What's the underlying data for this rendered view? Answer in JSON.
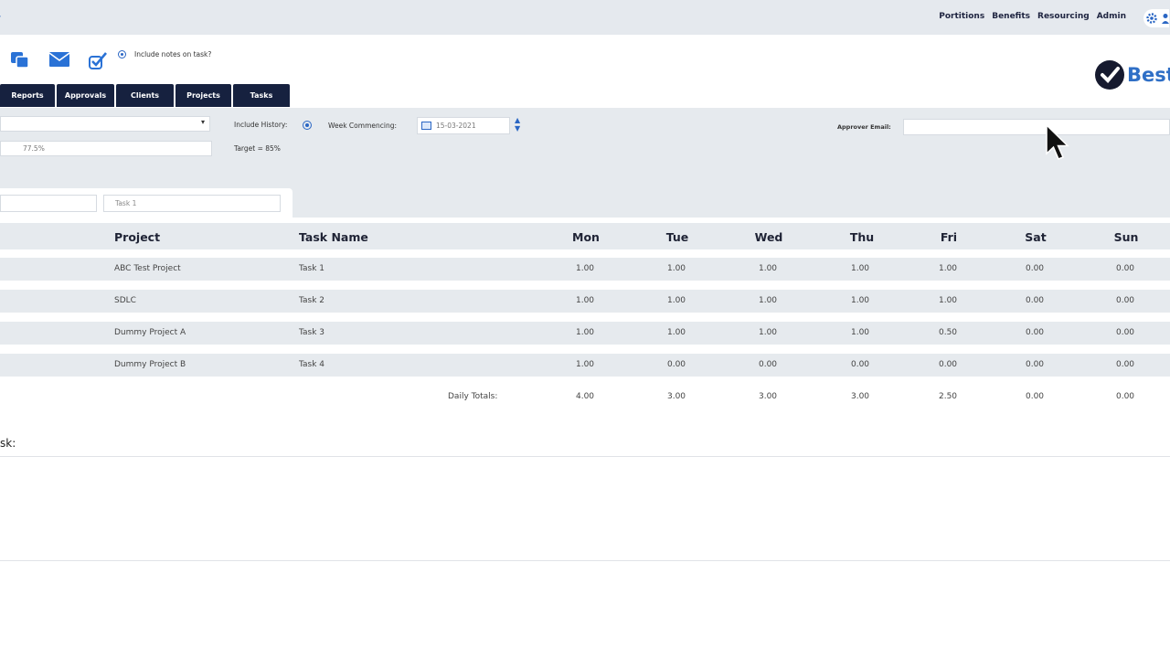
{
  "topnav": {
    "links": [
      "Portitions",
      "Benefits",
      "Resourcing",
      "Admin"
    ]
  },
  "toolbar": {
    "icons": [
      "copy-icon",
      "email-icon",
      "approve-check-icon"
    ],
    "include_notes_label": "Include notes on task?"
  },
  "brand": {
    "logo_text": "Best"
  },
  "tabs": [
    "Reports",
    "Approvals",
    "Clients",
    "Projects",
    "Tasks"
  ],
  "filters": {
    "include_history_label": "Include History:",
    "week_commencing_label": "Week Commencing:",
    "week_commencing_value": "15-03-2021",
    "utilisation_value": "77.5%",
    "target_label": "Target = 85%",
    "approver_email_label": "Approver Email:",
    "approver_email_value": "",
    "task_filter_value": "Task 1"
  },
  "table": {
    "columns": [
      "Project",
      "Task Name",
      "Mon",
      "Tue",
      "Wed",
      "Thu",
      "Fri",
      "Sat",
      "Sun"
    ],
    "rows": [
      {
        "project": "ABC Test Project",
        "task": "Task 1",
        "hours": [
          "1.00",
          "1.00",
          "1.00",
          "1.00",
          "1.00",
          "0.00",
          "0.00"
        ]
      },
      {
        "project": "SDLC",
        "task": "Task 2",
        "hours": [
          "1.00",
          "1.00",
          "1.00",
          "1.00",
          "1.00",
          "0.00",
          "0.00"
        ]
      },
      {
        "project": "Dummy Project A",
        "task": "Task 3",
        "hours": [
          "1.00",
          "1.00",
          "1.00",
          "1.00",
          "0.50",
          "0.00",
          "0.00"
        ]
      },
      {
        "project": "Dummy Project B",
        "task": "Task 4",
        "hours": [
          "1.00",
          "0.00",
          "0.00",
          "0.00",
          "0.00",
          "0.00",
          "0.00"
        ]
      }
    ],
    "totals_label": "Daily Totals:",
    "totals": [
      "4.00",
      "3.00",
      "3.00",
      "3.00",
      "2.50",
      "0.00",
      "0.00"
    ]
  },
  "notes_section": {
    "label": "sk:"
  },
  "colors": {
    "nav_dark": "#16213f",
    "accent_blue": "#2f6fc6",
    "panel_gray": "#e6eaee"
  }
}
